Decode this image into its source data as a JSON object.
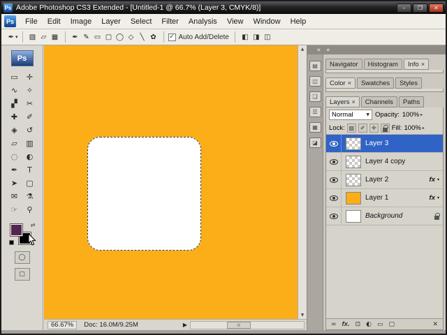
{
  "window": {
    "title": "Adobe Photoshop CS3 Extended - [Untitled-1 @ 66.7% (Layer 3, CMYK/8)]",
    "badge": "Ps"
  },
  "window_controls": {
    "minimize": "–",
    "maximize": "❐",
    "close": "✕"
  },
  "menu": {
    "items": [
      "File",
      "Edit",
      "Image",
      "Layer",
      "Select",
      "Filter",
      "Analysis",
      "View",
      "Window",
      "Help"
    ]
  },
  "options": {
    "preset_glyph": "✒",
    "dropdown": "▾",
    "check": "✓",
    "auto_add_delete_label": "Auto Add/Delete",
    "mode_glyphs": {
      "shape_layers": "▧",
      "paths": "▱",
      "fill_pixels": "▦"
    },
    "tool_glyphs": {
      "pen": "✒",
      "freeform_pen": "✎",
      "rect": "▭",
      "rounded_rect": "▢",
      "ellipse": "◯",
      "polygon": "◇",
      "line": "╲",
      "custom_shape": "✿"
    },
    "combine_glyphs": {
      "add": "◧",
      "subtract": "◨",
      "intersect": "◫"
    }
  },
  "toolbox": {
    "logo": "Ps",
    "swap_glyph": "⇄",
    "quick_mask_glyph": "◯",
    "screen_mode_glyph": "▢"
  },
  "tools": [
    {
      "name": "rectangular-marquee-tool",
      "glyph": "▭"
    },
    {
      "name": "move-tool",
      "glyph": "✛"
    },
    {
      "name": "lasso-tool",
      "glyph": "∿"
    },
    {
      "name": "quick-selection-tool",
      "glyph": "✧"
    },
    {
      "name": "crop-tool",
      "glyph": "▞"
    },
    {
      "name": "slice-tool",
      "glyph": "✂"
    },
    {
      "name": "healing-brush-tool",
      "glyph": "✚"
    },
    {
      "name": "brush-tool",
      "glyph": "✐"
    },
    {
      "name": "clone-stamp-tool",
      "glyph": "◈"
    },
    {
      "name": "history-brush-tool",
      "glyph": "↺"
    },
    {
      "name": "eraser-tool",
      "glyph": "▱"
    },
    {
      "name": "gradient-tool",
      "glyph": "▥"
    },
    {
      "name": "blur-tool",
      "glyph": "◌"
    },
    {
      "name": "dodge-tool",
      "glyph": "◐"
    },
    {
      "name": "pen-tool",
      "glyph": "✒"
    },
    {
      "name": "type-tool",
      "glyph": "T"
    },
    {
      "name": "path-selection-tool",
      "glyph": "➤"
    },
    {
      "name": "rectangle-tool",
      "glyph": "▢"
    },
    {
      "name": "notes-tool",
      "glyph": "✉"
    },
    {
      "name": "eyedropper-tool",
      "glyph": "⚗"
    },
    {
      "name": "hand-tool",
      "glyph": "☞"
    },
    {
      "name": "zoom-tool",
      "glyph": "⚲"
    }
  ],
  "dock": {
    "collapse": "«",
    "icons": [
      "▤",
      "◫",
      "❏",
      "☰",
      "▦",
      "◪"
    ]
  },
  "panels": {
    "collapse": "«",
    "tab_close": "×",
    "nav_tabs": [
      "Navigator",
      "Histogram",
      "Info"
    ],
    "color_tabs": [
      "Color",
      "Swatches",
      "Styles"
    ],
    "layers_tabs": [
      "Layers",
      "Channels",
      "Paths"
    ]
  },
  "layers_panel": {
    "blend_mode": "Normal",
    "opacity_label": "Opacity:",
    "opacity_value": "100%",
    "lock_label": "Lock:",
    "fill_label": "Fill:",
    "fill_value": "100%",
    "fx_label": "fx",
    "fx_caret": "▾",
    "dropdown": "▼",
    "spinner": "▸",
    "lock_glyphs": {
      "transparency": "▨",
      "image": "✐",
      "position": "✛"
    },
    "rows": [
      {
        "name": "Layer 3"
      },
      {
        "name": "Layer 4 copy"
      },
      {
        "name": "Layer 2"
      },
      {
        "name": "Layer 1"
      },
      {
        "name": "Background"
      }
    ],
    "bottom_icons": {
      "link": "∞",
      "style": "fx.",
      "mask": "⊡",
      "adjustment": "◐",
      "group": "▭",
      "new_layer": "▢",
      "delete": "✕"
    }
  },
  "status": {
    "zoom": "66.67%",
    "doc": "Doc: 16.0M/9.25M",
    "menu_arrow": "▶"
  },
  "scroll": {
    "up": "▲",
    "down": "▼",
    "grip": "≡"
  },
  "colors": {
    "canvas": "#FBAE17",
    "selected_layer": "#3063C6",
    "foreground_swatch": "#54254F",
    "background_swatch": "#000000"
  }
}
